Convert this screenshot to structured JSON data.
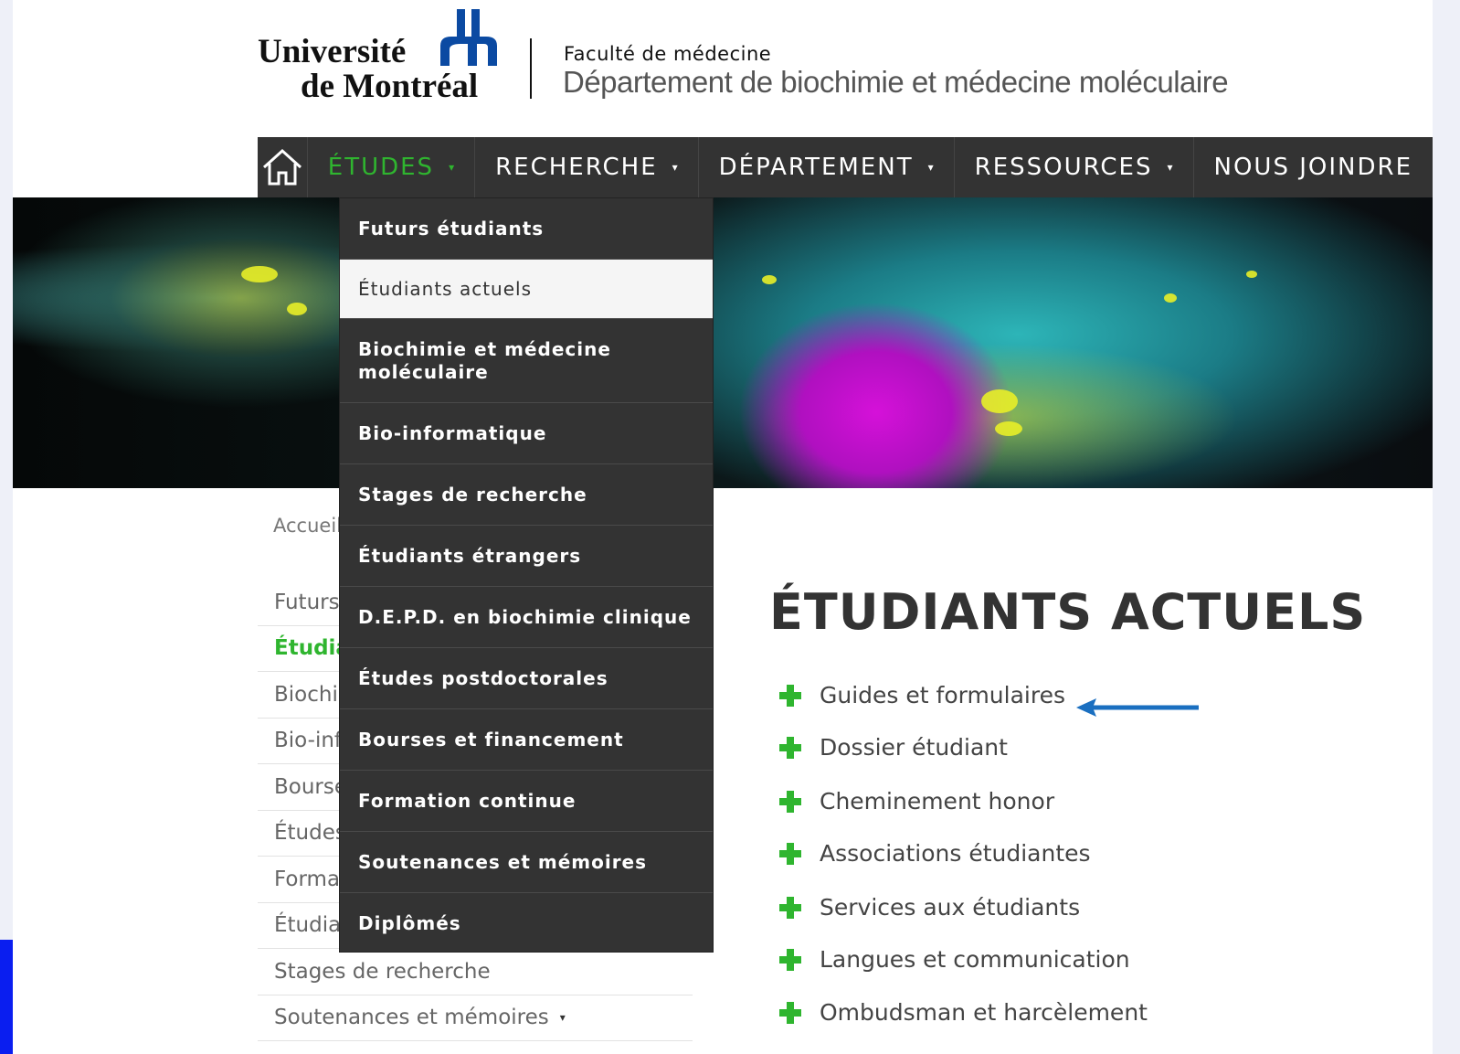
{
  "header": {
    "logo_line1": "Université",
    "logo_line2": "de Montréal",
    "faculty": "Faculté de médecine",
    "department": "Département de biochimie et médecine moléculaire"
  },
  "nav": {
    "home_icon": "home-icon",
    "items": [
      {
        "label": "ÉTUDES",
        "has_caret": true,
        "active": true
      },
      {
        "label": "RECHERCHE",
        "has_caret": true
      },
      {
        "label": "DÉPARTEMENT",
        "has_caret": true
      },
      {
        "label": "RESSOURCES",
        "has_caret": true
      },
      {
        "label": "NOUS JOINDRE",
        "has_caret": false
      }
    ],
    "caret": "▾"
  },
  "dropdown": {
    "items": [
      "Futurs étudiants",
      "Étudiants actuels",
      "Biochimie et médecine moléculaire",
      "Bio-informatique",
      "Stages de recherche",
      "Étudiants étrangers",
      "D.E.P.D. en biochimie clinique",
      "Études postdoctorales",
      "Bourses et financement",
      "Formation continue",
      "Soutenances et mémoires",
      "Diplômés"
    ],
    "hovered": "Étudiants actuels"
  },
  "breadcrumb": "Accueil",
  "subnav": {
    "items": [
      "Futurs étudiants",
      "Étudiants actuels",
      "Biochimie et médecine moléculaire",
      "Bio-informatique",
      "Bourses et financement",
      "Études postdoctorales",
      "Formation continue",
      "Étudiants étrangers",
      "Stages de recherche",
      "Soutenances et mémoires"
    ],
    "active": "Étudiants actuels"
  },
  "main": {
    "title": "ÉTUDIANTS ACTUELS",
    "links": [
      "Guides et formulaires",
      "Dossier étudiant",
      "Cheminement honor",
      "Associations étudiantes",
      "Services aux étudiants",
      "Langues et communication",
      "Ombudsman et harcèlement"
    ]
  },
  "colors": {
    "accent_green": "#2fb52f",
    "nav_bg": "#333333",
    "annotation_arrow": "#1a6fc0"
  }
}
